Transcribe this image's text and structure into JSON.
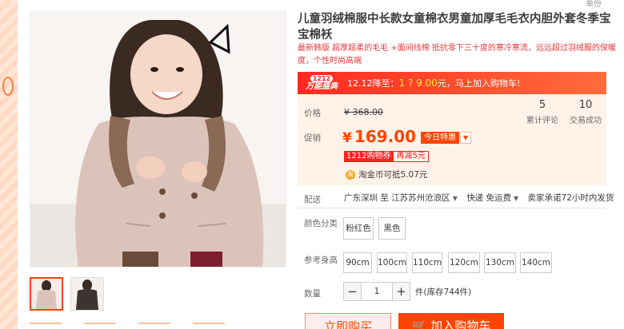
{
  "header": {
    "corner": "单份"
  },
  "product": {
    "title": "儿童羽绒棉服中长款女童棉衣男童加厚毛毛衣内胆外套冬季宝宝棉袄",
    "subtitle_red": "最新韩版 超厚超柔的毛毛 +面间线棉 抵抗零下三十度的寒冷寒流，远远超过羽绒服的保暖度，个性时尚高端",
    "subtitle_gray": ""
  },
  "promo": {
    "logo_top": "1212",
    "logo_bottom": "万能盛典",
    "text_prefix": "12.12降至：",
    "price": "1 ? 9.00",
    "text_suffix": "元，马上加入购物车!"
  },
  "price": {
    "label_price": "价格",
    "original": "¥ 368.00",
    "label_promo": "促销",
    "current_symbol": "¥",
    "current": "169.00",
    "today_tag": "今日特惠",
    "coupon_a": "1212购物券",
    "coupon_b": "再减5元",
    "taojin": "淘金币可抵5.07元"
  },
  "stats": {
    "reviews_count": "5",
    "reviews_label": "累计评论",
    "sales_count": "10",
    "sales_label": "交易成功"
  },
  "shipping": {
    "label": "配送",
    "from": "广东深圳",
    "to_label": "至",
    "to": "江苏苏州沧浪区",
    "method": "快递 免运费",
    "promise": "卖家承诺72小时内发货"
  },
  "color": {
    "label": "颜色分类",
    "options": [
      "粉红色",
      "黑色"
    ]
  },
  "size": {
    "label": "参考身高",
    "options": [
      "90cm",
      "100cm",
      "110cm",
      "120cm",
      "130cm",
      "140cm"
    ]
  },
  "quantity": {
    "label": "数量",
    "value": "1",
    "minus": "−",
    "plus": "+",
    "stock": "件(库存744件)"
  },
  "actions": {
    "buy_now": "立即购买",
    "add_cart": "加入购物车"
  },
  "colors": {
    "accent": "#ff4400",
    "promo_bg": "#ff2a1f",
    "price_box_bg": "#fff2e8"
  }
}
